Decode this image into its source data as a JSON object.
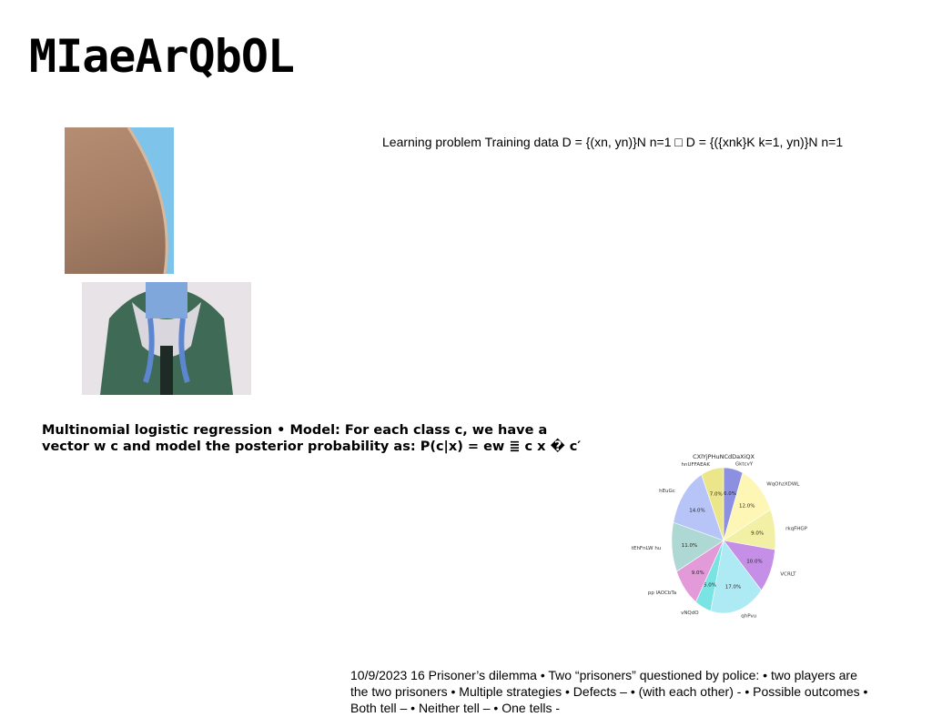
{
  "slide": {
    "title": "MIaeArQbOL",
    "top_text": "Learning problem Training data D = {(xn, yn)}N n=1 □ D = {({xnk}K k=1, yn)}N n=1",
    "mid_text": "Multinomial logistic regression • Model: For each class c, we have a vector w c and model the posterior probability as: P(c|x) = ew ≣ c x � c′",
    "bottom_text": "10/9/2023 16 Prisoner’s dilemma • Two “prisoners” questioned by police: • two players are the two prisoners • Multiple strategies • Defects – • (with each other) - • Possible outcomes • Both tell – • Neither tell – • One tells -"
  },
  "chart_data": {
    "type": "pie",
    "title": "CXlYjPHuNCdDaXiQX",
    "categories": [
      "GktcvY",
      "WqOhzXDWL",
      "rkqFHGP",
      "VCRLT",
      "qhPvu",
      "vNQdO",
      "pp lAOCbTa",
      "tEhFnLW hu",
      "hEuGc",
      "hnUFFAEAK"
    ],
    "values": [
      6.0,
      12.0,
      9.0,
      10.0,
      17.0,
      5.0,
      9.0,
      11.0,
      14.0,
      7.0
    ],
    "colors": [
      "#8d8fe0",
      "#fdf6b4",
      "#f2f0a4",
      "#c58fe8",
      "#aeeaf3",
      "#7ae4e4",
      "#e39ad8",
      "#aed8d3",
      "#b6c4f8",
      "#ece68a"
    ]
  }
}
